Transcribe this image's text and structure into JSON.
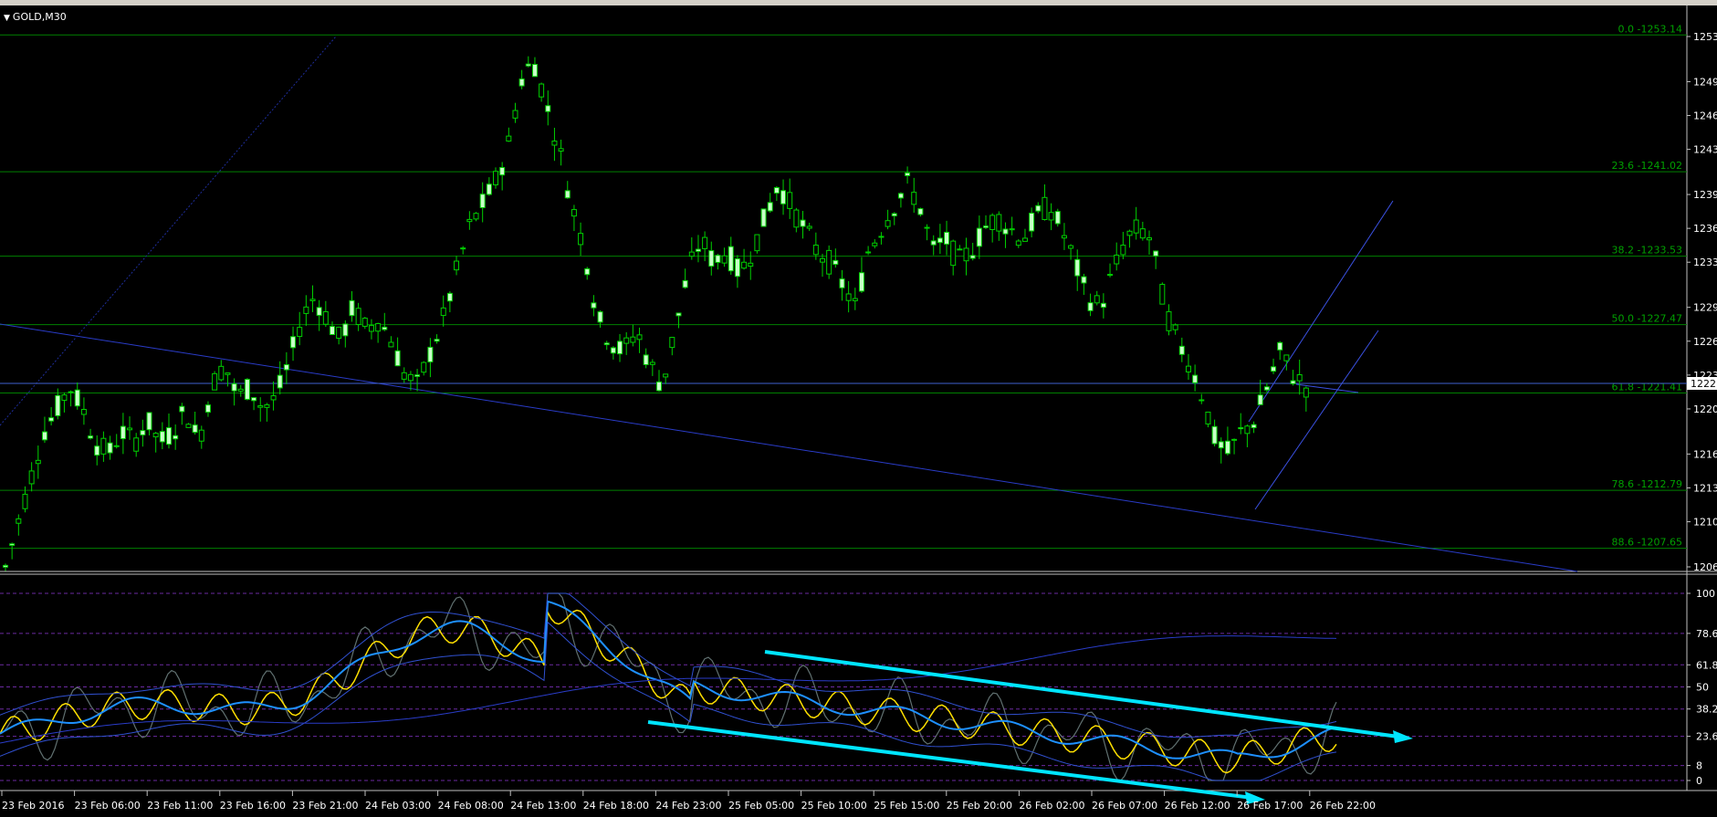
{
  "window": {
    "symbol": "GOLD,M30"
  },
  "price_axis": {
    "ticks": [
      "1253",
      "1249",
      "1246",
      "1243",
      "1239",
      "1236",
      "1233",
      "1229",
      "1226",
      "1223",
      "1220",
      "1216",
      "1213",
      "1210",
      "1206"
    ],
    "current_price": "1222"
  },
  "fibonacci": {
    "levels": [
      {
        "label": "0.0 -1253.14",
        "price": 1253.14
      },
      {
        "label": "23.6 -1241.02",
        "price": 1241.02
      },
      {
        "label": "38.2 -1233.53",
        "price": 1233.53
      },
      {
        "label": "50.0 -1227.47",
        "price": 1227.47
      },
      {
        "label": "61.8 -1221.41",
        "price": 1221.41
      },
      {
        "label": "78.6 -1212.79",
        "price": 1212.79
      },
      {
        "label": "88.6 -1207.65",
        "price": 1207.65
      }
    ]
  },
  "time_axis": {
    "labels": [
      "23 Feb 2016",
      "23 Feb 06:00",
      "23 Feb 11:00",
      "23 Feb 16:00",
      "23 Feb 21:00",
      "24 Feb 03:00",
      "24 Feb 08:00",
      "24 Feb 13:00",
      "24 Feb 18:00",
      "24 Feb 23:00",
      "25 Feb 05:00",
      "25 Feb 10:00",
      "25 Feb 15:00",
      "25 Feb 20:00",
      "26 Feb 02:00",
      "26 Feb 07:00",
      "26 Feb 12:00",
      "26 Feb 17:00",
      "26 Feb 22:00"
    ]
  },
  "oscillator": {
    "levels": [
      "100",
      "78.6",
      "61.8",
      "50",
      "38.2",
      "23.6",
      "8",
      "0"
    ]
  },
  "colors": {
    "background": "#000000",
    "grid_green": "#008000",
    "fib_text": "#00a000",
    "trendline_blue": "#2a3cc8",
    "bull_candle": "#c8ffc8",
    "bear_candle": "#000000",
    "arrow_cyan": "#00e5ff",
    "osc_yellow": "#ffe000",
    "osc_blue": "#1e90ff",
    "osc_gray": "#708080"
  },
  "chart_data": {
    "type": "candlestick",
    "symbol": "GOLD",
    "timeframe": "M30",
    "ylim": [
      1205,
      1255
    ],
    "price_path": [
      1206,
      1210,
      1214,
      1218,
      1220,
      1222,
      1220,
      1217,
      1216,
      1218,
      1217,
      1219,
      1217,
      1218,
      1220,
      1217,
      1222,
      1224,
      1221,
      1222,
      1220,
      1221,
      1224,
      1228,
      1230,
      1228,
      1226,
      1229,
      1227,
      1228,
      1226,
      1223,
      1222,
      1225,
      1228,
      1232,
      1236,
      1238,
      1240,
      1243,
      1249,
      1251,
      1247,
      1243,
      1238,
      1234,
      1228,
      1226,
      1225,
      1227,
      1224,
      1222,
      1227,
      1232,
      1235,
      1233,
      1234,
      1232,
      1234,
      1237,
      1240,
      1238,
      1236,
      1234,
      1233,
      1231,
      1229,
      1234,
      1236,
      1238,
      1240,
      1238,
      1234,
      1235,
      1233,
      1234,
      1236,
      1237,
      1236,
      1235,
      1237,
      1238,
      1236,
      1233,
      1230,
      1229,
      1232,
      1235,
      1236,
      1235,
      1229,
      1226,
      1224,
      1221,
      1217,
      1216,
      1218,
      1219,
      1222,
      1225,
      1223,
      1222
    ],
    "current": 1222
  }
}
